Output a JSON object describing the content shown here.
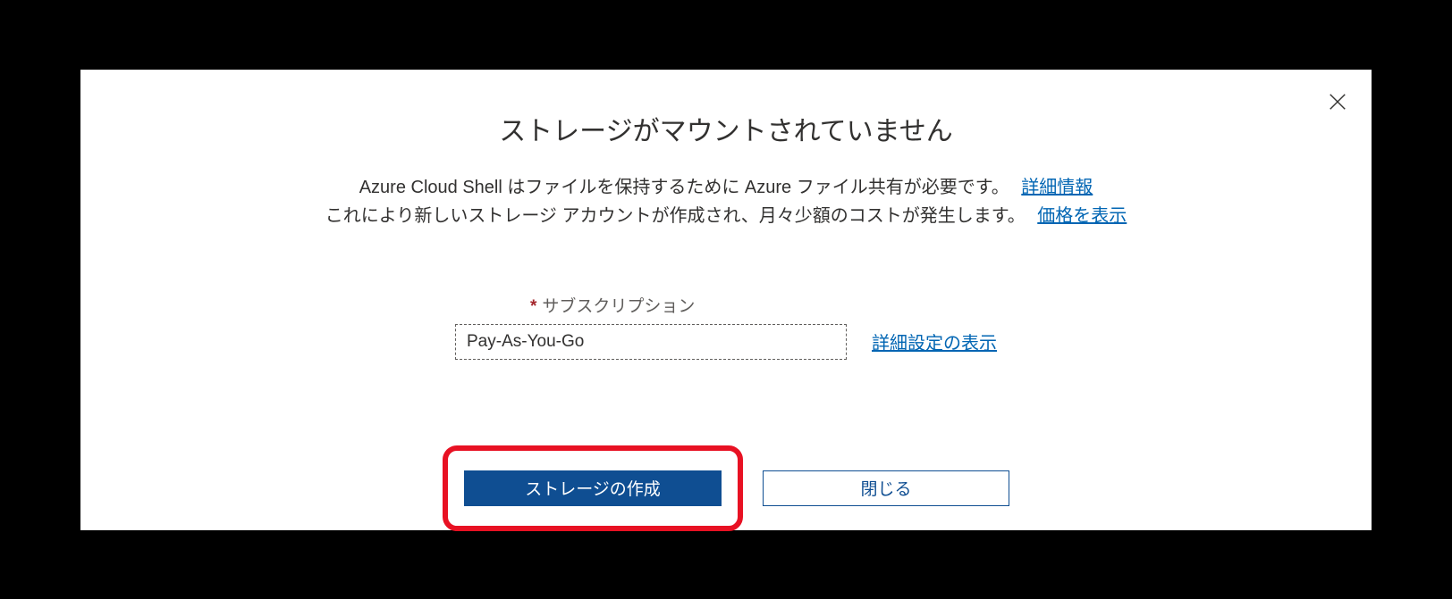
{
  "dialog": {
    "title": "ストレージがマウントされていません",
    "description_line1_text": "Azure Cloud Shell はファイルを保持するために Azure ファイル共有が必要です。",
    "description_line1_link": "詳細情報",
    "description_line2_text": "これにより新しいストレージ アカウントが作成され、月々少額のコストが発生します。",
    "description_line2_link": "価格を表示"
  },
  "form": {
    "required_mark": "*",
    "subscription_label": "サブスクリプション",
    "subscription_value": "Pay-As-You-Go",
    "advanced_link": "詳細設定の表示"
  },
  "buttons": {
    "create_storage": "ストレージの作成",
    "close": "閉じる"
  },
  "colors": {
    "link": "#0065b3",
    "primary": "#0f4e92",
    "highlight": "#e81123",
    "required": "#a4262c"
  }
}
